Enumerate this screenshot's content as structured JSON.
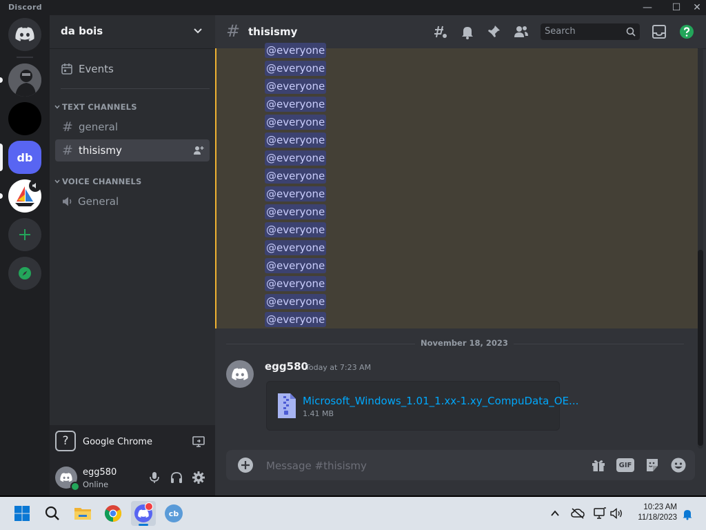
{
  "window": {
    "title": "Discord"
  },
  "guilds": {
    "active_initials": "db"
  },
  "server": {
    "name": "da bois",
    "events_label": "Events"
  },
  "categories": {
    "text": "TEXT CHANNELS",
    "voice": "VOICE CHANNELS"
  },
  "channels": {
    "text": [
      "general",
      "thisismy"
    ],
    "voice": [
      "General"
    ]
  },
  "activity": {
    "name": "Google Chrome"
  },
  "user": {
    "name": "egg580",
    "status": "Online"
  },
  "topbar": {
    "channel": "thisismy",
    "search_placeholder": "Search"
  },
  "mentions": [
    "@everyone",
    "@everyone",
    "@everyone",
    "@everyone",
    "@everyone",
    "@everyone",
    "@everyone",
    "@everyone",
    "@everyone",
    "@everyone",
    "@everyone",
    "@everyone",
    "@everyone",
    "@everyone",
    "@everyone",
    "@everyone"
  ],
  "date_divider": "November 18, 2023",
  "message": {
    "author": "egg580",
    "time": "Today at 7:23 AM",
    "attachment": {
      "name": "Microsoft_Windows_1.01_1.xx-1.xy_CompuData_OE...",
      "size": "1.41 MB"
    }
  },
  "composer": {
    "placeholder": "Message #thisismy",
    "gif_label": "GIF"
  },
  "taskbar": {
    "time": "10:23 AM",
    "date": "11/18/2023",
    "cb_label": "cb"
  },
  "colors": {
    "blurple": "#5865f2",
    "green": "#23a55a",
    "mention_bg": "#3c4270",
    "highlight_border": "#f0b232",
    "link": "#00a8fc"
  }
}
